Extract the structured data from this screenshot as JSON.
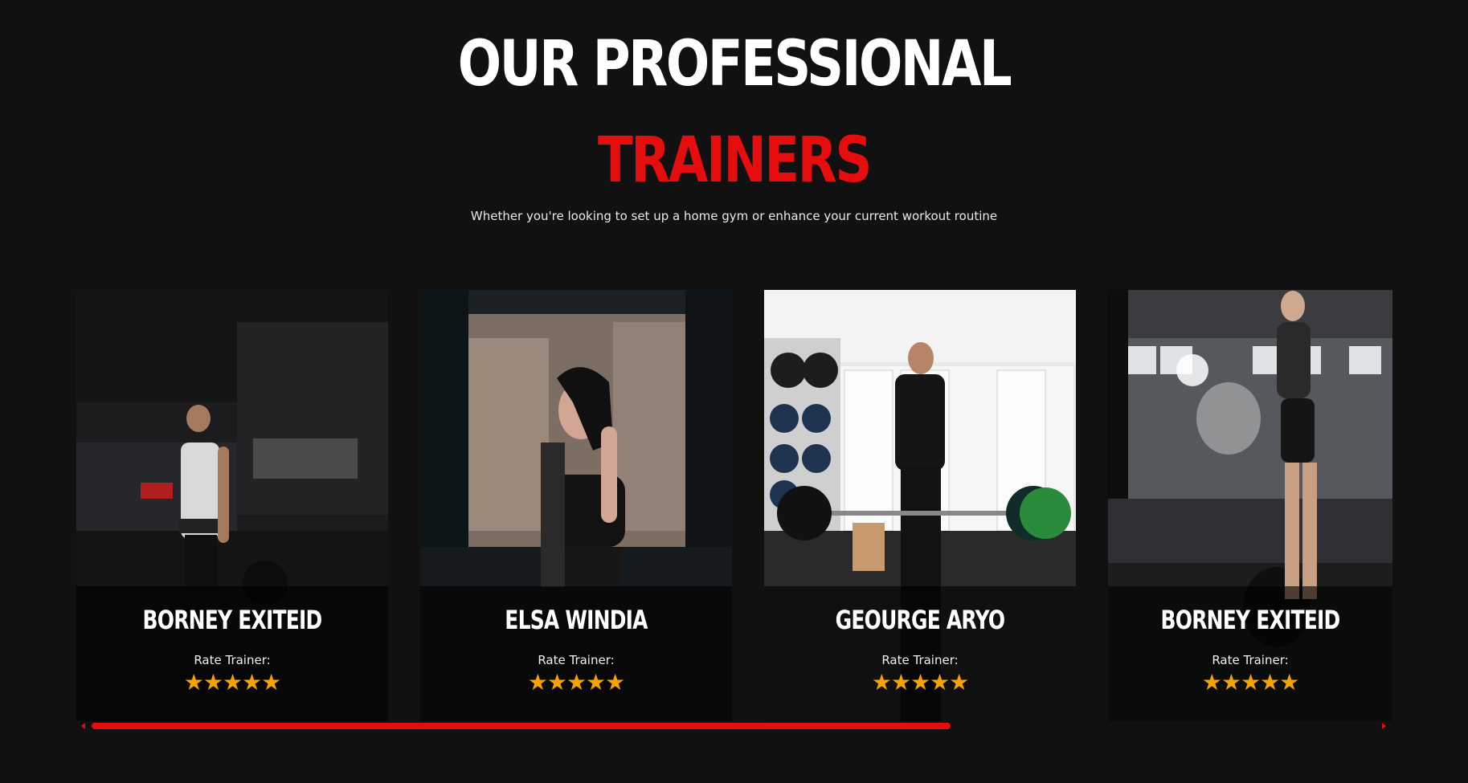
{
  "heading": {
    "line1": "OUR PROFESSIONAL",
    "line2": "TRAINERS",
    "subtitle": "Whether you're looking to set up a home gym or enhance your current workout routine"
  },
  "colors": {
    "accent": "#e50d0d",
    "star": "#f5a300",
    "background": "#111112"
  },
  "trainers": [
    {
      "name": "BORNEY EXITEID",
      "rate_label": "Rate Trainer:",
      "stars": "★★★★★",
      "rating": 5
    },
    {
      "name": "ELSA WINDIA",
      "rate_label": "Rate Trainer:",
      "stars": "★★★★★",
      "rating": 5
    },
    {
      "name": "GEOURGE ARYO",
      "rate_label": "Rate Trainer:",
      "stars": "★★★★★",
      "rating": 5
    },
    {
      "name": "BORNEY EXITEID",
      "rate_label": "Rate Trainer:",
      "stars": "★★★★★",
      "rating": 5
    }
  ],
  "scrollbar": {
    "position": 0,
    "visible_fraction": 0.76
  }
}
